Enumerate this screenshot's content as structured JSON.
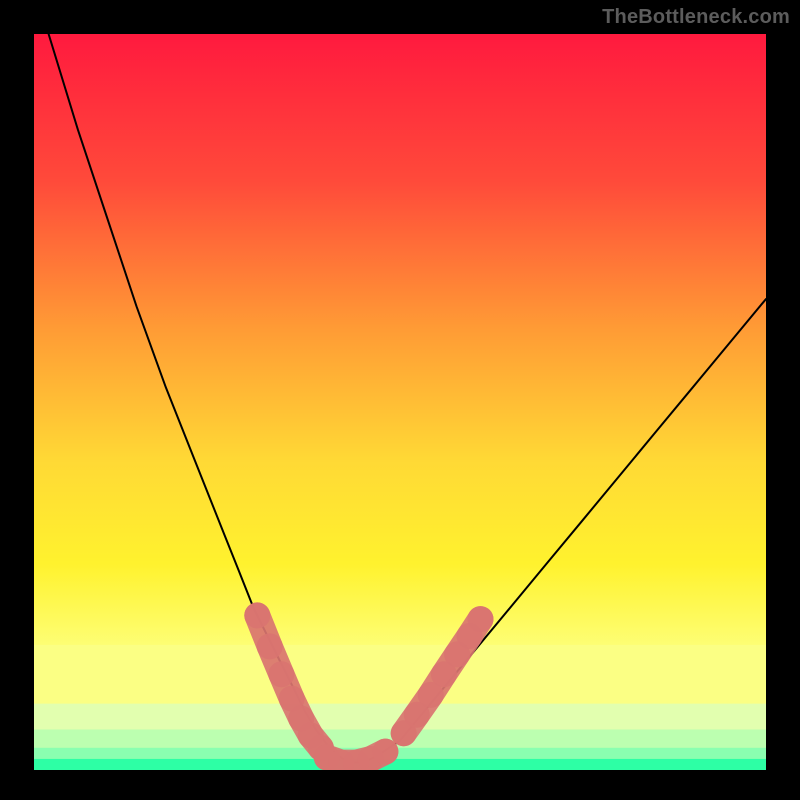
{
  "watermark": "TheBottleneck.com",
  "chart_data": {
    "type": "line",
    "title": "",
    "xlabel": "",
    "ylabel": "",
    "xlim": [
      0,
      100
    ],
    "ylim": [
      0,
      100
    ],
    "background_gradient": {
      "stops": [
        {
          "offset": 0,
          "color": "#ff1a3e"
        },
        {
          "offset": 20,
          "color": "#ff4a3a"
        },
        {
          "offset": 40,
          "color": "#ff9b35"
        },
        {
          "offset": 58,
          "color": "#ffd935"
        },
        {
          "offset": 72,
          "color": "#fff22e"
        },
        {
          "offset": 84,
          "color": "#fdff7a"
        },
        {
          "offset": 90,
          "color": "#f3ffb0"
        },
        {
          "offset": 100,
          "color": "#2bffa3"
        }
      ]
    },
    "yellow_green_bands": [
      {
        "y": 83,
        "height": 8,
        "color": "#fbff84"
      },
      {
        "y": 91,
        "height": 3.5,
        "color": "#e2ffaf"
      },
      {
        "y": 94.5,
        "height": 2.5,
        "color": "#bcffb0"
      },
      {
        "y": 97,
        "height": 1.5,
        "color": "#8affb0"
      },
      {
        "y": 98.5,
        "height": 1.5,
        "color": "#2dffa5"
      }
    ],
    "series": [
      {
        "name": "curve",
        "color": "#000000",
        "stroke_width": 2,
        "x": [
          2,
          6,
          10,
          14,
          18,
          22,
          26,
          28,
          30,
          32,
          34,
          35.5,
          37,
          38.5,
          40,
          41.5,
          43,
          45,
          47,
          50,
          55,
          60,
          65,
          70,
          75,
          80,
          85,
          90,
          95,
          100
        ],
        "y": [
          0,
          13,
          25,
          37,
          48,
          58,
          68,
          73,
          78,
          82,
          86,
          89,
          92,
          94.5,
          96.5,
          98,
          99,
          99,
          98,
          96,
          90,
          84,
          78,
          72,
          66,
          60,
          54,
          48,
          42,
          36
        ]
      }
    ],
    "marker_segments": [
      {
        "name": "left-descent",
        "points": [
          {
            "x": 30.5,
            "y": 79
          },
          {
            "x": 32.2,
            "y": 83.2
          },
          {
            "x": 33.8,
            "y": 87
          },
          {
            "x": 35.2,
            "y": 90.3
          },
          {
            "x": 36.5,
            "y": 93
          },
          {
            "x": 37.8,
            "y": 95.3
          },
          {
            "x": 39.2,
            "y": 97
          }
        ]
      },
      {
        "name": "valley-floor",
        "points": [
          {
            "x": 40,
            "y": 98.3
          },
          {
            "x": 42,
            "y": 99
          },
          {
            "x": 44,
            "y": 99
          },
          {
            "x": 46,
            "y": 98.5
          },
          {
            "x": 48,
            "y": 97.5
          }
        ]
      },
      {
        "name": "right-ascent",
        "points": [
          {
            "x": 50.5,
            "y": 95
          },
          {
            "x": 52.3,
            "y": 92.5
          },
          {
            "x": 54.2,
            "y": 89.8
          },
          {
            "x": 56,
            "y": 87
          },
          {
            "x": 57.8,
            "y": 84.3
          },
          {
            "x": 59.5,
            "y": 81.8
          },
          {
            "x": 61,
            "y": 79.5
          }
        ]
      }
    ],
    "marker_style": {
      "color": "#d97470",
      "radius": 13
    }
  }
}
